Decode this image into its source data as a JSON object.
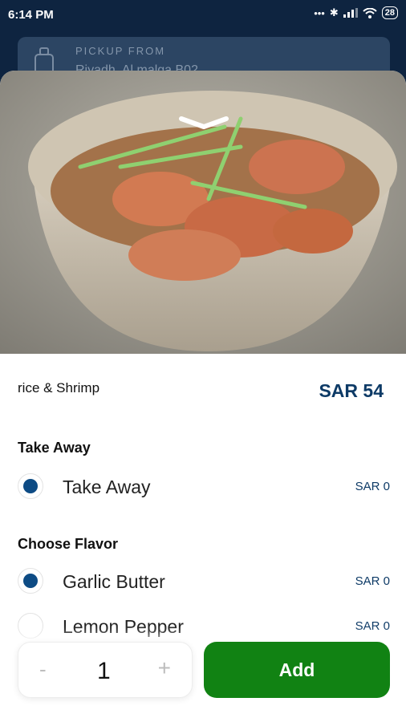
{
  "status_bar": {
    "time": "6:14 PM",
    "battery": "28"
  },
  "pickup": {
    "label": "PICKUP FROM",
    "location": "Riyadh, Al malqa B02"
  },
  "product": {
    "title": "rice & Shrimp",
    "price": "SAR 54"
  },
  "sections": [
    {
      "title": "Take Away",
      "options": [
        {
          "name": "Take Away",
          "price": "SAR 0",
          "selected": true
        }
      ]
    },
    {
      "title": "Choose Flavor",
      "options": [
        {
          "name": "Garlic Butter",
          "price": "SAR 0",
          "selected": true
        },
        {
          "name": "Lemon Pepper",
          "price": "SAR 0",
          "selected": false
        }
      ]
    }
  ],
  "footer": {
    "minus": "-",
    "quantity": "1",
    "plus": "+",
    "add_label": "Add"
  },
  "colors": {
    "accent": "#0d3a66",
    "radio": "#0d4b84",
    "add_button": "#118213",
    "status_bg": "#0e2440"
  },
  "icons": [
    "wifi-icon",
    "signal-icon",
    "bluetooth-icon",
    "chevron-down-icon",
    "store-icon"
  ]
}
